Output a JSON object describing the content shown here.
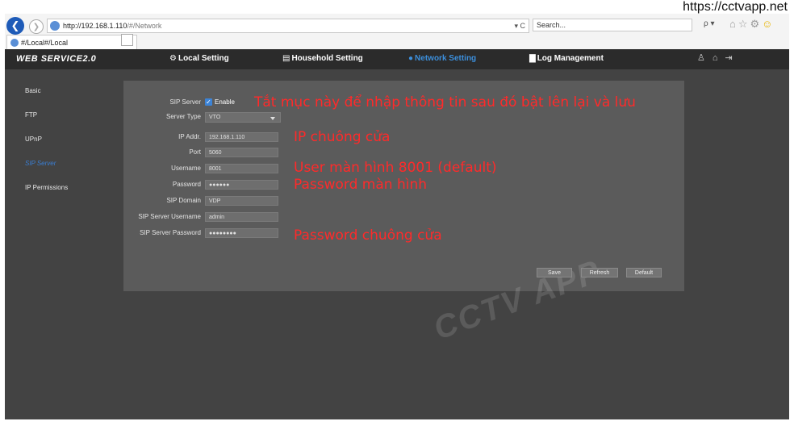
{
  "watermark_url": "https://cctvapp.net",
  "browser": {
    "url_host": "http://192.168.1.110",
    "url_path": "/#/Network",
    "address_controls": "▾ C",
    "search_placeholder": "Search...",
    "search_controls": "ρ ▾",
    "tab_title": "#/Local#/Local",
    "tab_close": "×"
  },
  "app": {
    "brand": "WEB SERVICE2.0",
    "menu": [
      {
        "icon": "gear-icon",
        "label": "Local Setting"
      },
      {
        "icon": "building-icon",
        "label": "Household Setting"
      },
      {
        "icon": "globe-icon",
        "label": "Network Setting",
        "active": true
      },
      {
        "icon": "document-icon",
        "label": "Log Management"
      }
    ],
    "sidebar": [
      {
        "label": "Basic"
      },
      {
        "label": "FTP"
      },
      {
        "label": "UPnP"
      },
      {
        "label": "SIP Server",
        "active": true
      },
      {
        "label": "IP Permissions"
      }
    ]
  },
  "form": {
    "sip_server": {
      "label": "SIP Server",
      "enable_label": "Enable",
      "checked": true
    },
    "server_type": {
      "label": "Server Type",
      "value": "VTO"
    },
    "ip_addr": {
      "label": "IP Addr.",
      "value": "192.168.1.110"
    },
    "port": {
      "label": "Port",
      "value": "5060"
    },
    "username": {
      "label": "Username",
      "value": "8001"
    },
    "password": {
      "label": "Password",
      "value": "●●●●●●"
    },
    "sip_domain": {
      "label": "SIP Domain",
      "value": "VDP"
    },
    "sip_server_username": {
      "label": "SIP Server Username",
      "value": "admin"
    },
    "sip_server_password": {
      "label": "SIP Server Password",
      "value": "●●●●●●●●"
    },
    "buttons": {
      "save": "Save",
      "refresh": "Refresh",
      "default": "Default"
    }
  },
  "annotations": {
    "sip_server": "Tắt mục này để nhập thông tin sau đó bật lên lại và lưu",
    "ip": "IP chuông cửa",
    "user": "User màn hình 8001 (default)",
    "password": "Password màn hình",
    "server_password": "Password chuông cửa"
  },
  "colors": {
    "accent": "#3c8fdc",
    "annotation": "#ff2a2a",
    "header_bg": "#2b2b2b",
    "panel_bg": "#5b5b5b"
  }
}
